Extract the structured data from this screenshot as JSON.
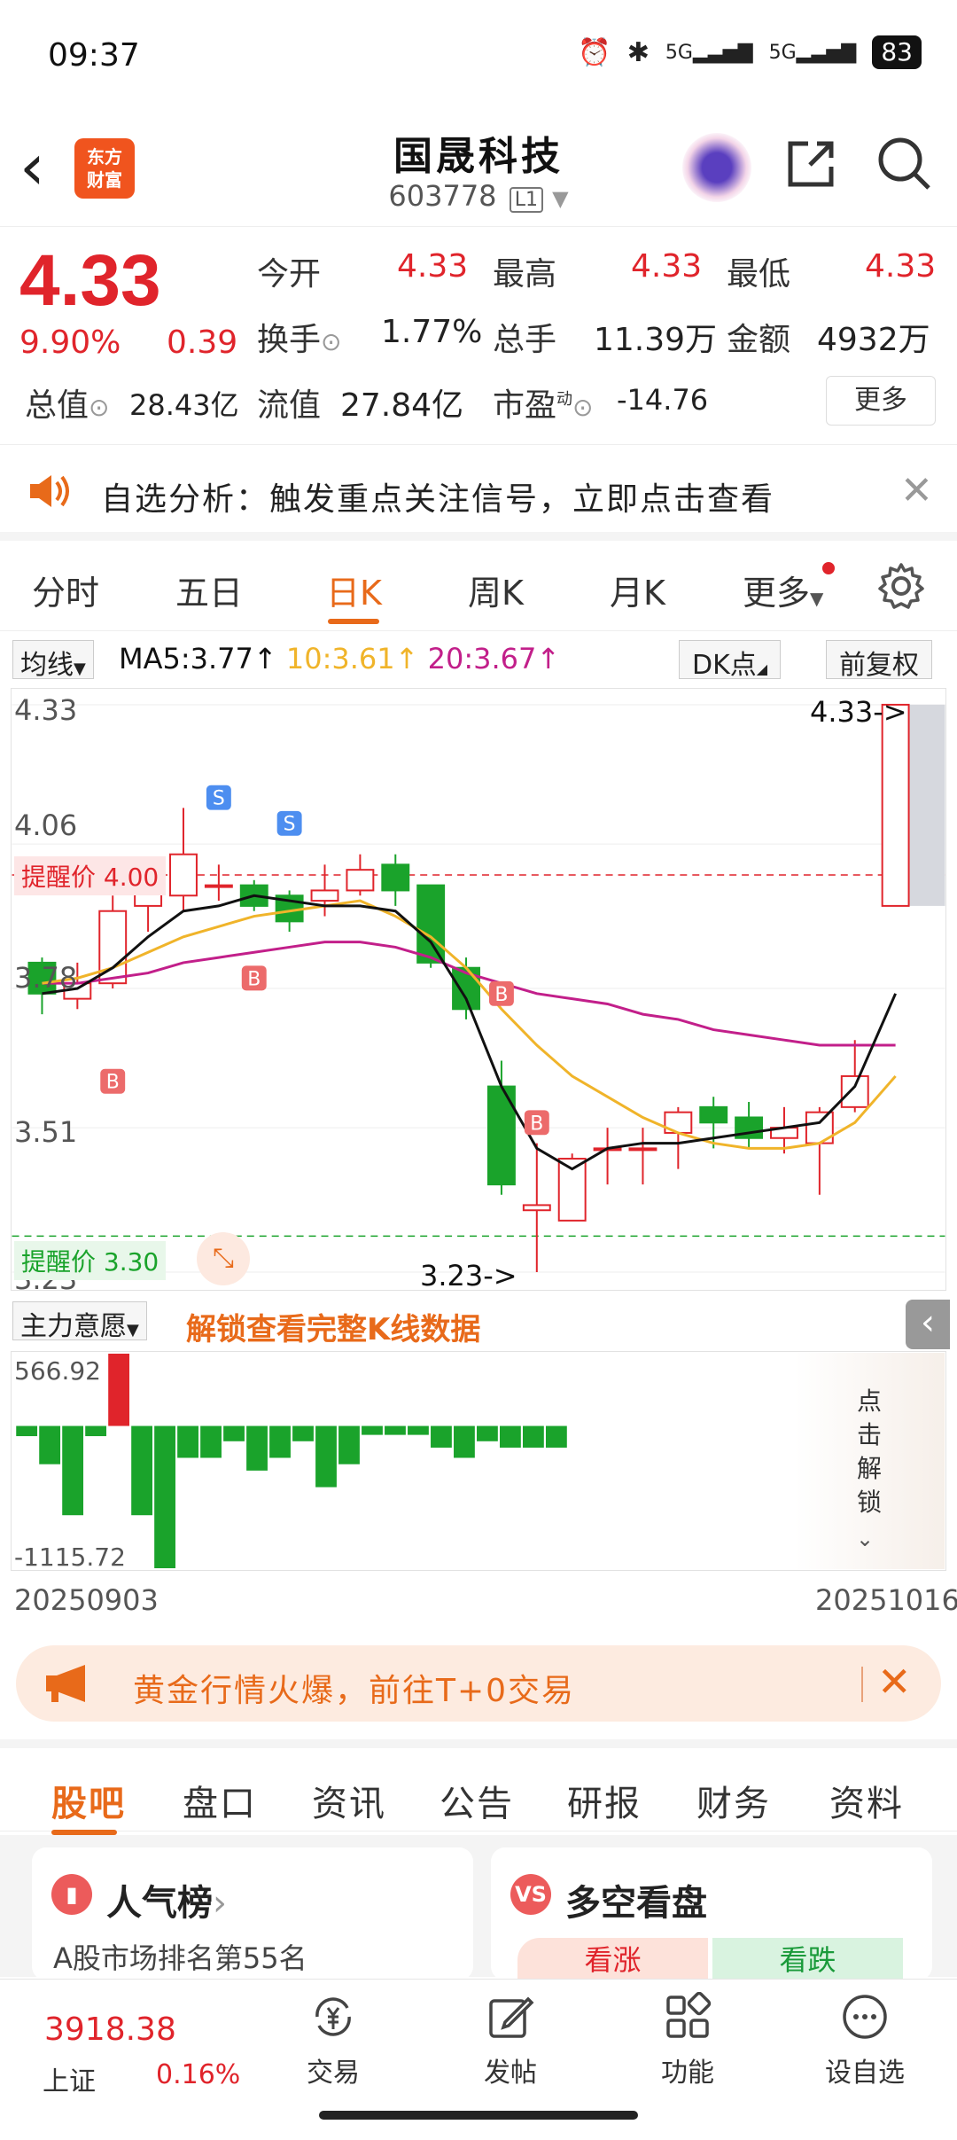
{
  "status": {
    "time": "09:37",
    "signal1": "5G",
    "signal2": "5G",
    "battery": "83"
  },
  "header": {
    "logo_line1": "东方",
    "logo_line2": "财富",
    "stock_name": "国晟科技",
    "stock_code": "603778",
    "level": "L1"
  },
  "quote": {
    "price": "4.33",
    "pct": "9.90%",
    "change": "0.39",
    "open_label": "今开",
    "open": "4.33",
    "high_label": "最高",
    "high": "4.33",
    "low_label": "最低",
    "low": "4.33",
    "turnover_label": "换手",
    "turnover": "1.77%",
    "volume_label": "总手",
    "volume": "11.39万",
    "amount_label": "金额",
    "amount": "4932万",
    "mcap_label": "总值",
    "mcap": "28.43亿",
    "float_label": "流值",
    "float": "27.84亿",
    "pe_label": "市盈",
    "pe_sup": "动",
    "pe": "-14.76",
    "more": "更多"
  },
  "alert": {
    "text": "自选分析：触发重点关注信号，立即点击查看"
  },
  "period_tabs": [
    "分时",
    "五日",
    "日K",
    "周K",
    "月K",
    "更多"
  ],
  "active_period": "日K",
  "ma": {
    "selector": "均线",
    "ma5": "MA5:3.77↑",
    "ma10": "10:3.61↑",
    "ma20": "20:3.67↑",
    "dk": "DK点",
    "adjust": "前复权"
  },
  "colors": {
    "up": "#e0242b",
    "down": "#1aa32b",
    "ma5": "#111111",
    "ma10": "#f0b42a",
    "ma20": "#c21f8a",
    "accent": "#e86a1a"
  },
  "chart_data": {
    "type": "candlestick",
    "ylim": [
      3.23,
      4.33
    ],
    "y_ticks": [
      "4.33",
      "4.06",
      "3.78",
      "3.51",
      "3.23"
    ],
    "x_range": [
      "20250903",
      "20251016"
    ],
    "alerts": [
      "提醒价 4.00",
      "提醒价 3.30"
    ],
    "max_label": "4.33->",
    "min_label": "3.23->",
    "signals": [
      "S",
      "S",
      "B",
      "B",
      "B",
      "B"
    ],
    "candles": [
      {
        "o": 3.83,
        "c": 3.77,
        "h": 3.84,
        "l": 3.73
      },
      {
        "o": 3.76,
        "c": 3.79,
        "h": 3.83,
        "l": 3.74
      },
      {
        "o": 3.79,
        "c": 3.93,
        "h": 3.96,
        "l": 3.78
      },
      {
        "o": 3.94,
        "c": 4.0,
        "h": 4.01,
        "l": 3.89
      },
      {
        "o": 3.96,
        "c": 4.04,
        "h": 4.13,
        "l": 3.93
      },
      {
        "o": 3.98,
        "c": 3.98,
        "h": 4.02,
        "l": 3.95
      },
      {
        "o": 3.98,
        "c": 3.94,
        "h": 3.99,
        "l": 3.93
      },
      {
        "o": 3.96,
        "c": 3.91,
        "h": 3.97,
        "l": 3.89
      },
      {
        "o": 3.95,
        "c": 3.97,
        "h": 4.02,
        "l": 3.92
      },
      {
        "o": 3.97,
        "c": 4.01,
        "h": 4.04,
        "l": 3.96
      },
      {
        "o": 4.02,
        "c": 3.97,
        "h": 4.04,
        "l": 3.94
      },
      {
        "o": 3.98,
        "c": 3.83,
        "h": 3.98,
        "l": 3.82
      },
      {
        "o": 3.82,
        "c": 3.74,
        "h": 3.84,
        "l": 3.72
      },
      {
        "o": 3.59,
        "c": 3.4,
        "h": 3.64,
        "l": 3.38
      },
      {
        "o": 3.35,
        "c": 3.36,
        "h": 3.48,
        "l": 3.23
      },
      {
        "o": 3.33,
        "c": 3.45,
        "h": 3.46,
        "l": 3.33
      },
      {
        "o": 3.47,
        "c": 3.47,
        "h": 3.51,
        "l": 3.4
      },
      {
        "o": 3.47,
        "c": 3.47,
        "h": 3.51,
        "l": 3.4
      },
      {
        "o": 3.5,
        "c": 3.54,
        "h": 3.55,
        "l": 3.43
      },
      {
        "o": 3.55,
        "c": 3.52,
        "h": 3.57,
        "l": 3.47
      },
      {
        "o": 3.53,
        "c": 3.49,
        "h": 3.56,
        "l": 3.47
      },
      {
        "o": 3.49,
        "c": 3.51,
        "h": 3.55,
        "l": 3.46
      },
      {
        "o": 3.48,
        "c": 3.54,
        "h": 3.55,
        "l": 3.38
      },
      {
        "o": 3.55,
        "c": 3.61,
        "h": 3.68,
        "l": 3.54
      },
      {
        "o": 3.94,
        "c": 4.33,
        "h": 4.33,
        "l": 4.33
      }
    ],
    "ma5": [
      3.77,
      3.78,
      3.82,
      3.88,
      3.93,
      3.94,
      3.96,
      3.95,
      3.94,
      3.94,
      3.93,
      3.87,
      3.76,
      3.59,
      3.47,
      3.43,
      3.47,
      3.48,
      3.48,
      3.49,
      3.5,
      3.51,
      3.52,
      3.59,
      3.77
    ],
    "ma10": [
      3.79,
      3.8,
      3.82,
      3.85,
      3.88,
      3.9,
      3.92,
      3.93,
      3.94,
      3.95,
      3.92,
      3.88,
      3.82,
      3.74,
      3.67,
      3.61,
      3.57,
      3.53,
      3.5,
      3.48,
      3.47,
      3.47,
      3.48,
      3.52,
      3.61
    ],
    "ma20": [
      3.79,
      3.79,
      3.8,
      3.81,
      3.83,
      3.84,
      3.85,
      3.86,
      3.87,
      3.87,
      3.86,
      3.84,
      3.81,
      3.79,
      3.77,
      3.76,
      3.75,
      3.73,
      3.72,
      3.7,
      3.69,
      3.68,
      3.67,
      3.67,
      3.67
    ]
  },
  "sub_indicator": {
    "selector": "主力意愿",
    "unlock_text": "解锁查看完整K线数据",
    "side_unlock": "点击解锁",
    "top": "566.92",
    "bottom": "-1115.72"
  },
  "fund_flow": [
    -80,
    -300,
    -700,
    -80,
    566.92,
    -700,
    -1115.72,
    -250,
    -250,
    -120,
    -350,
    -250,
    -120,
    -480,
    -300,
    -70,
    -70,
    -70,
    -170,
    -250,
    -120,
    -170,
    -170,
    -170
  ],
  "dates": {
    "start": "20250903",
    "end": "20251016"
  },
  "promo": {
    "text": "黄金行情火爆，前往T+0交易"
  },
  "content_tabs": [
    "股吧",
    "盘口",
    "资讯",
    "公告",
    "研报",
    "财务",
    "资料"
  ],
  "cards": {
    "popularity_title": "人气榜",
    "popularity_text": "A股市场排名第55名",
    "vs_title": "多空看盘",
    "bull": "看涨",
    "bear": "看跌"
  },
  "nav": {
    "index_value": "3918.38",
    "index_name": "上证",
    "index_pct": "0.16%",
    "items": [
      "交易",
      "发帖",
      "功能",
      "设自选"
    ]
  }
}
